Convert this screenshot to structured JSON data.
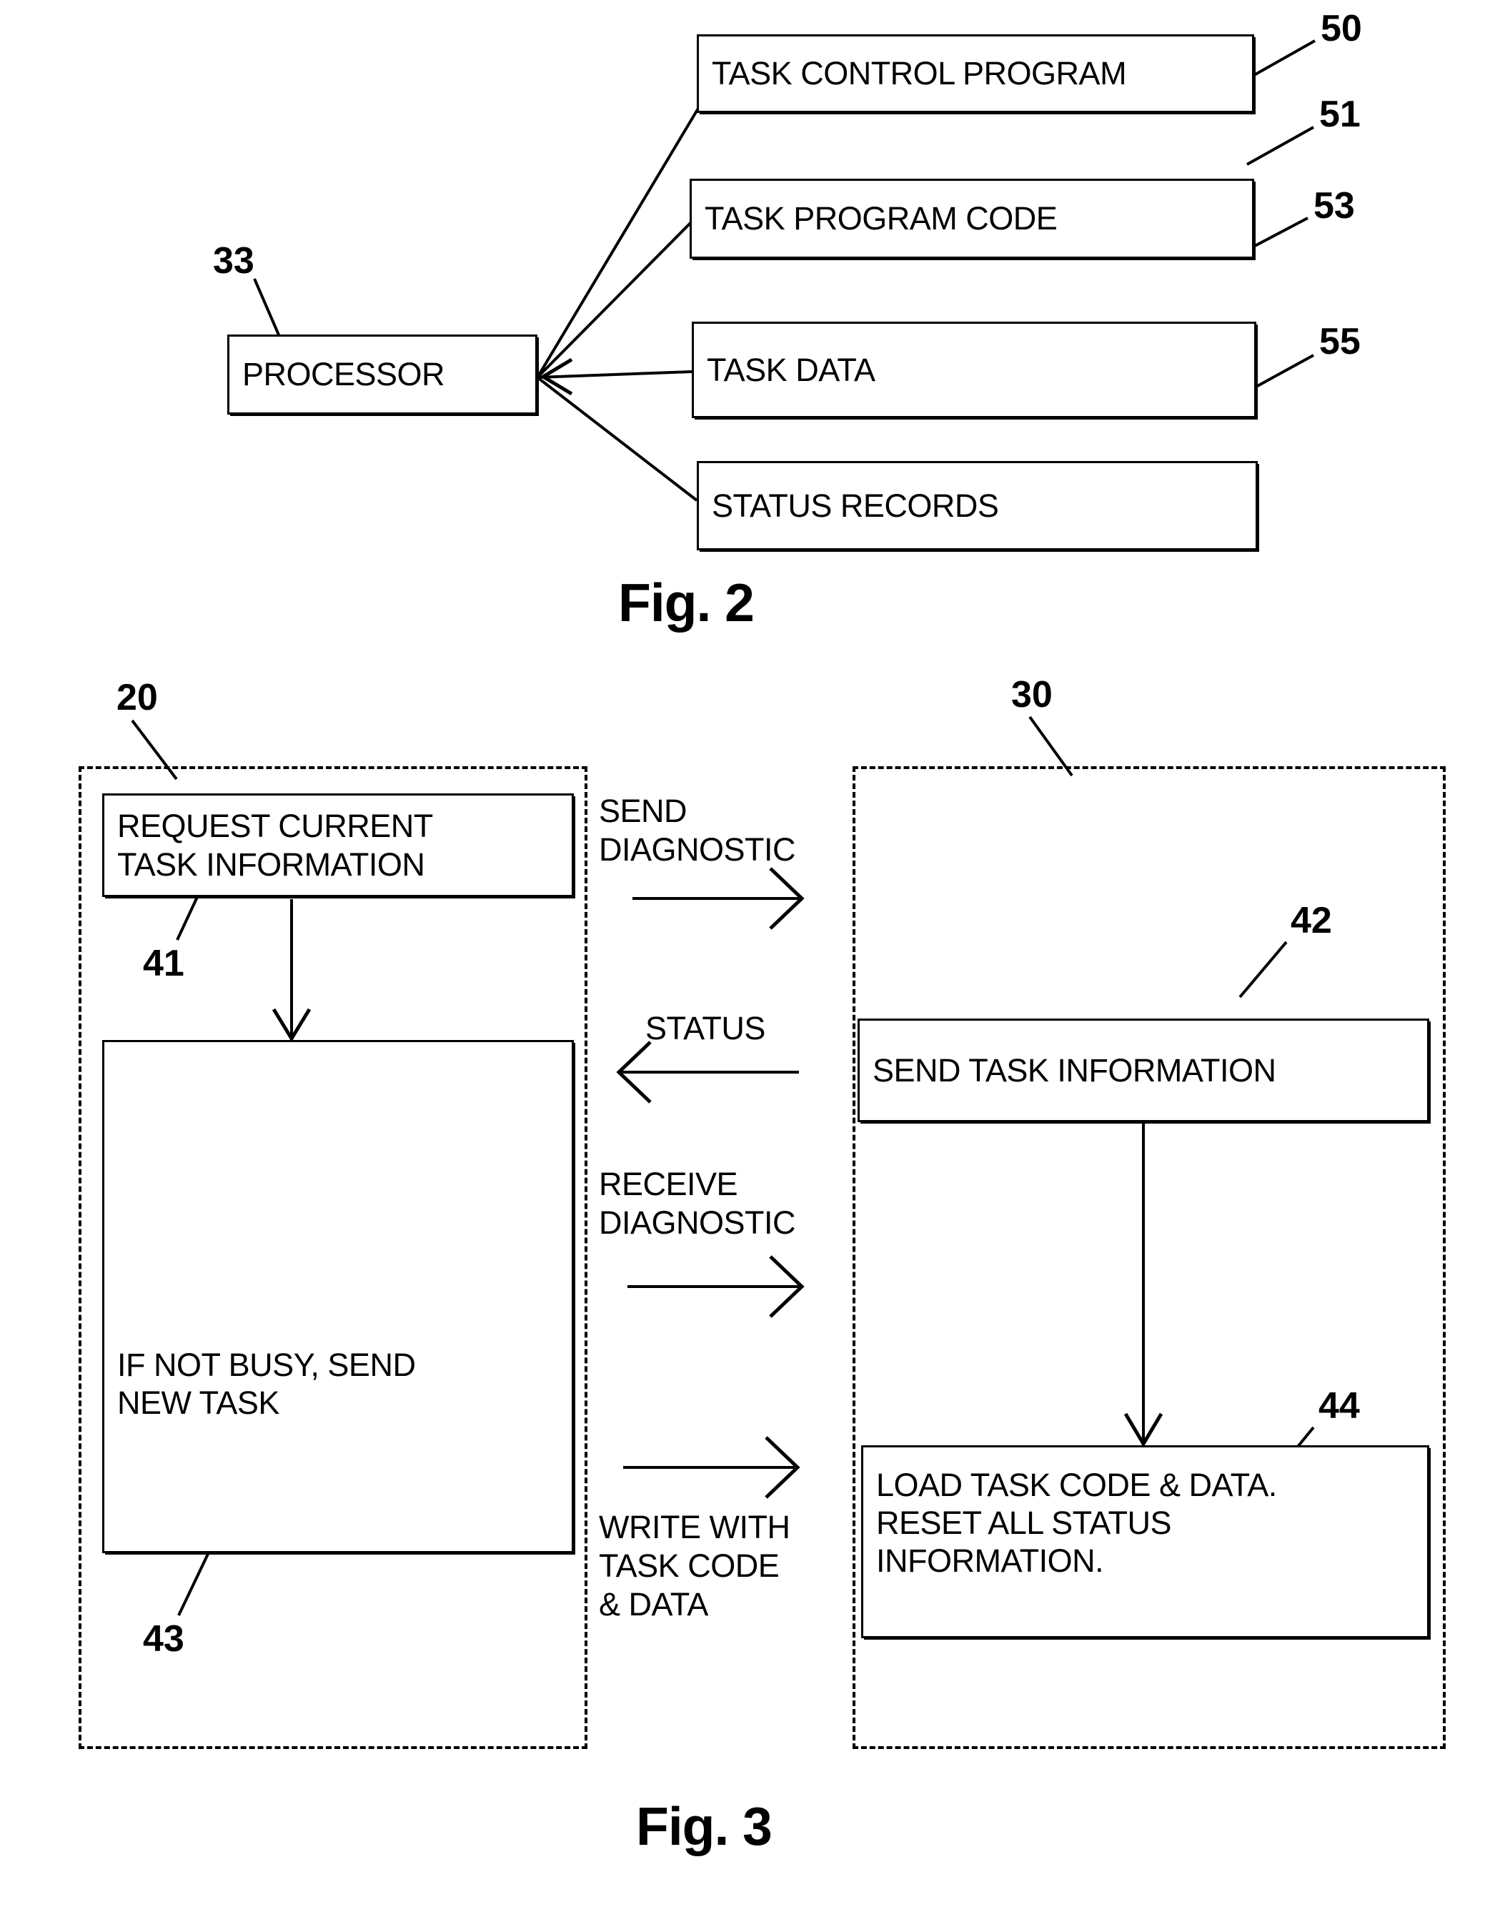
{
  "figure2": {
    "caption": "Fig. 2",
    "processor": {
      "label": "PROCESSOR",
      "ref": "33"
    },
    "blocks": [
      {
        "label": "TASK CONTROL PROGRAM",
        "ref": "50"
      },
      {
        "label": "TASK PROGRAM CODE",
        "ref": "51"
      },
      {
        "label": "TASK DATA",
        "ref": "53"
      },
      {
        "label": "STATUS RECORDS",
        "ref": "55"
      }
    ]
  },
  "figure3": {
    "caption": "Fig. 3",
    "lanes": [
      {
        "ref": "20",
        "side": "left"
      },
      {
        "ref": "30",
        "side": "right"
      }
    ],
    "left_blocks": [
      {
        "label": "REQUEST CURRENT\nTASK INFORMATION",
        "ref": "41"
      },
      {
        "label": "IF NOT BUSY, SEND\nNEW TASK",
        "ref": "43"
      }
    ],
    "right_blocks": [
      {
        "label": "SEND TASK INFORMATION",
        "ref": "42"
      },
      {
        "label": "LOAD TASK CODE & DATA.\nRESET ALL STATUS\nINFORMATION.",
        "ref": "44"
      }
    ],
    "messages": [
      {
        "label": "SEND\nDIAGNOSTIC",
        "direction": "right"
      },
      {
        "label": "STATUS",
        "direction": "left"
      },
      {
        "label": "RECEIVE\nDIAGNOSTIC",
        "direction": "right"
      },
      {
        "label": "WRITE WITH\nTASK CODE\n& DATA",
        "direction": "right"
      }
    ]
  },
  "colors": {
    "ink": "#000000",
    "paper": "#ffffff"
  }
}
